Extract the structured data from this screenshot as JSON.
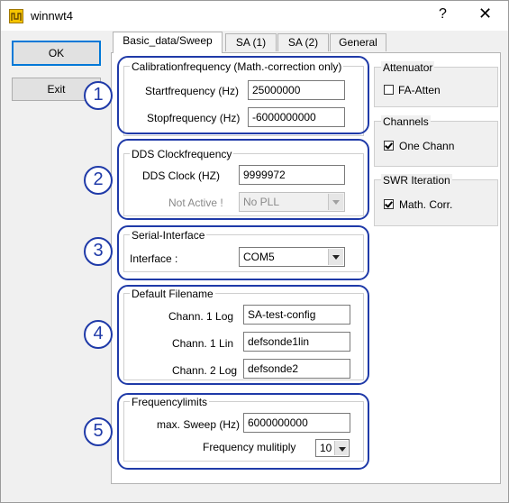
{
  "window": {
    "title": "winnwt4",
    "help_glyph": "?",
    "close_glyph": "✕"
  },
  "buttons": {
    "ok": "OK",
    "exit": "Exit"
  },
  "tabs": [
    "Basic_data/Sweep",
    "SA (1)",
    "SA (2)",
    "General"
  ],
  "calibration": {
    "title": "Calibrationfrequency (Math.-correction only)",
    "start_label": "Startfrequency (Hz)",
    "start_value": "25000000",
    "stop_label": "Stopfrequency (Hz)",
    "stop_value": "-6000000000"
  },
  "dds": {
    "title": "DDS Clockfrequency",
    "clock_label": "DDS Clock (HZ)",
    "clock_value": "9999972",
    "notactive_label": "Not Active !",
    "pll_value": "No PLL"
  },
  "serial": {
    "title": "Serial-Interface",
    "interface_label": "Interface :",
    "interface_value": "COM5"
  },
  "filename": {
    "title": "Default Filename",
    "rows": [
      {
        "label": "Chann. 1  Log",
        "value": "SA-test-config"
      },
      {
        "label": "Chann. 1  Lin",
        "value": "defsonde1lin"
      },
      {
        "label": "Chann. 2 Log",
        "value": "defsonde2"
      }
    ]
  },
  "freqlimits": {
    "title": "Frequencylimits",
    "maxsweep_label": "max. Sweep (Hz)",
    "maxsweep_value": "6000000000",
    "multiply_label": "Frequency mulitiply",
    "multiply_value": "10"
  },
  "attenuator": {
    "title": "Attenuator",
    "option": "FA-Atten",
    "checked": false
  },
  "channels": {
    "title": "Channels",
    "option": "One Chann",
    "checked": true
  },
  "swr": {
    "title": "SWR Iteration",
    "option": "Math. Corr.",
    "checked": true
  },
  "annotations": [
    "1",
    "2",
    "3",
    "4",
    "5"
  ],
  "colors": {
    "annotation": "#1f3aa8",
    "focus": "#0078d7"
  }
}
